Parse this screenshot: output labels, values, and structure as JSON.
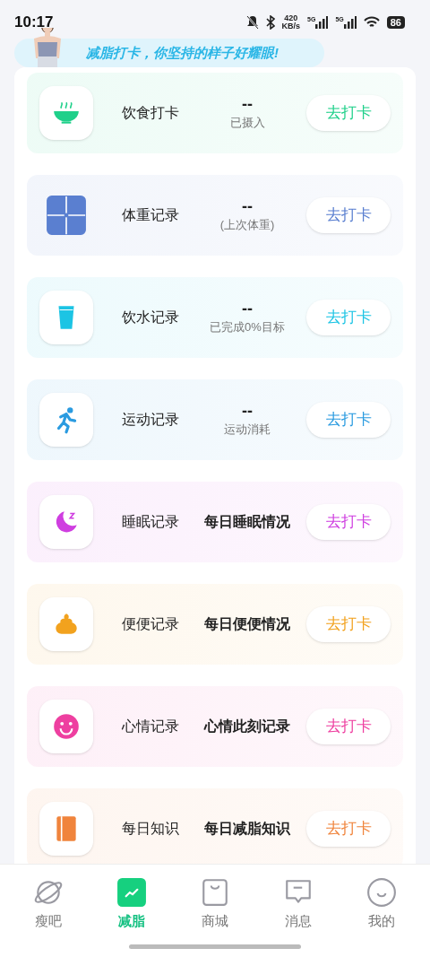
{
  "status_bar": {
    "time": "10:17",
    "net_speed": [
      "420",
      "KB/s"
    ],
    "signal_labels": [
      "5G",
      "5G"
    ],
    "battery": "86"
  },
  "banner": {
    "text": "减脂打卡，你坚持的样子好耀眼!"
  },
  "cards": [
    {
      "kind": "value",
      "title": "饮食打卡",
      "value": "--",
      "caption": "已摄入",
      "button": "去打卡",
      "color": "#1fd08a"
    },
    {
      "kind": "value",
      "title": "体重记录",
      "value": "--",
      "caption": "(上次体重)",
      "button": "去打卡",
      "color": "#5a7fd0"
    },
    {
      "kind": "value",
      "title": "饮水记录",
      "value": "--",
      "caption": "已完成0%目标",
      "button": "去打卡",
      "color": "#1cc4e4"
    },
    {
      "kind": "value",
      "title": "运动记录",
      "value": "--",
      "caption": "运动消耗",
      "button": "去打卡",
      "color": "#2a9be0"
    },
    {
      "kind": "text",
      "title": "睡眠记录",
      "description": "每日睡眠情况",
      "button": "去打卡",
      "color": "#cf3ee0"
    },
    {
      "kind": "text",
      "title": "便便记录",
      "description": "每日便便情况",
      "button": "去打卡",
      "color": "#f2a21e"
    },
    {
      "kind": "text",
      "title": "心情记录",
      "description": "心情此刻记录",
      "button": "去打卡",
      "color": "#ee3fa0"
    },
    {
      "kind": "text",
      "title": "每日知识",
      "description": "每日减脂知识",
      "button": "去打卡",
      "color": "#f0843c"
    }
  ],
  "tabs": [
    {
      "label": "瘦吧",
      "selected": false
    },
    {
      "label": "减脂",
      "selected": true
    },
    {
      "label": "商城",
      "selected": false
    },
    {
      "label": "消息",
      "selected": false
    },
    {
      "label": "我的",
      "selected": false
    }
  ]
}
